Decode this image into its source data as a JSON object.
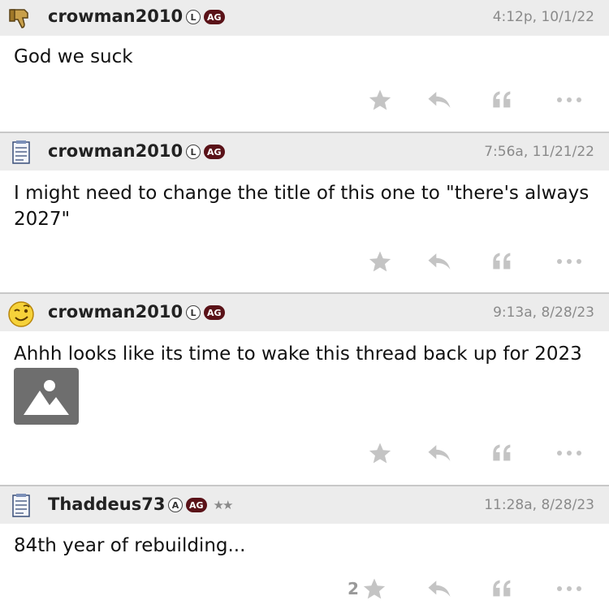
{
  "posts": [
    {
      "username": "crowman2010",
      "badge_letter": "L",
      "badge_ag": "AG",
      "rank_stars": "",
      "timestamp": "4:12p, 10/1/22",
      "text": "God we suck",
      "avatar_icon": "thumbs-down-icon",
      "like_count": ""
    },
    {
      "username": "crowman2010",
      "badge_letter": "L",
      "badge_ag": "AG",
      "rank_stars": "",
      "timestamp": "7:56a, 11/21/22",
      "text": "I might need to change the title of this one to \"there's always 2027\"",
      "avatar_icon": "notepad-icon",
      "like_count": ""
    },
    {
      "username": "crowman2010",
      "badge_letter": "L",
      "badge_ag": "AG",
      "rank_stars": "",
      "timestamp": "9:13a, 8/28/23",
      "text": "Ahhh looks like its time to wake this thread back up for 2023",
      "avatar_icon": "winking-face-icon",
      "like_count": "",
      "has_image": true
    },
    {
      "username": "Thaddeus73",
      "badge_letter": "A",
      "badge_ag": "AG",
      "rank_stars": "★★",
      "timestamp": "11:28a, 8/28/23",
      "text": "84th year of rebuilding...",
      "avatar_icon": "notepad-icon",
      "like_count": "2"
    }
  ],
  "colors": {
    "header_bg": "#ececec",
    "badge_ag_bg": "#5a1218",
    "action_icon": "#c4c4c4",
    "timestamp": "#8a8a8a"
  }
}
